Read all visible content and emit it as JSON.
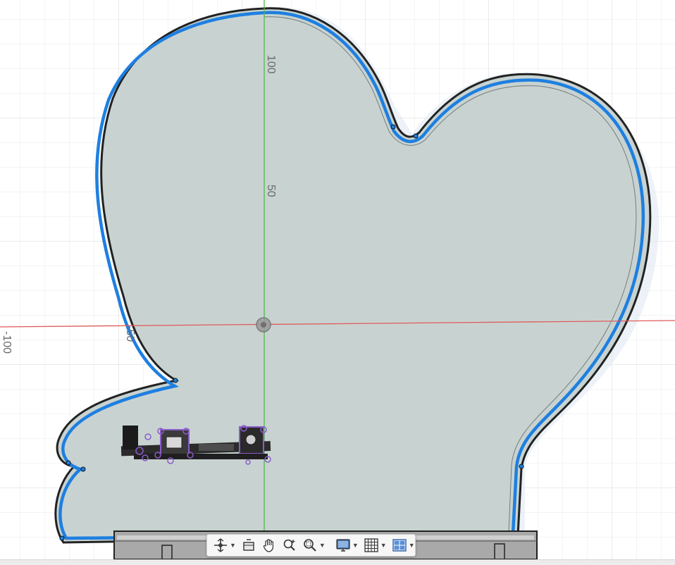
{
  "viewport": {
    "axis_labels": {
      "v_100": "100",
      "v_50": "50",
      "h_neg100": "-100",
      "h_neg50": "-50"
    },
    "colors": {
      "background": "#ffffff",
      "grid_minor": "#e6e6e6",
      "grid_major": "#cfcfcf",
      "x_axis": "#e05a5a",
      "y_axis": "#4cb84c",
      "body_fill": "#c8d3d1",
      "profile_outline": "#222222",
      "selection_blue": "#1e7fe0",
      "component_purple": "#8b5cc8"
    }
  },
  "toolbar": {
    "items": [
      {
        "id": "orbit",
        "icon": "orbit-icon",
        "has_dropdown": true
      },
      {
        "id": "look-at",
        "icon": "look-at-icon",
        "has_dropdown": false
      },
      {
        "id": "pan",
        "icon": "pan-hand-icon",
        "has_dropdown": false
      },
      {
        "id": "zoom",
        "icon": "zoom-icon",
        "has_dropdown": false
      },
      {
        "id": "zoom-window",
        "icon": "zoom-window-icon",
        "has_dropdown": true
      },
      {
        "id": "display-settings",
        "icon": "display-settings-icon",
        "has_dropdown": true
      },
      {
        "id": "grid-snaps",
        "icon": "grid-icon",
        "has_dropdown": true
      },
      {
        "id": "viewports",
        "icon": "viewports-icon",
        "has_dropdown": true
      }
    ]
  }
}
